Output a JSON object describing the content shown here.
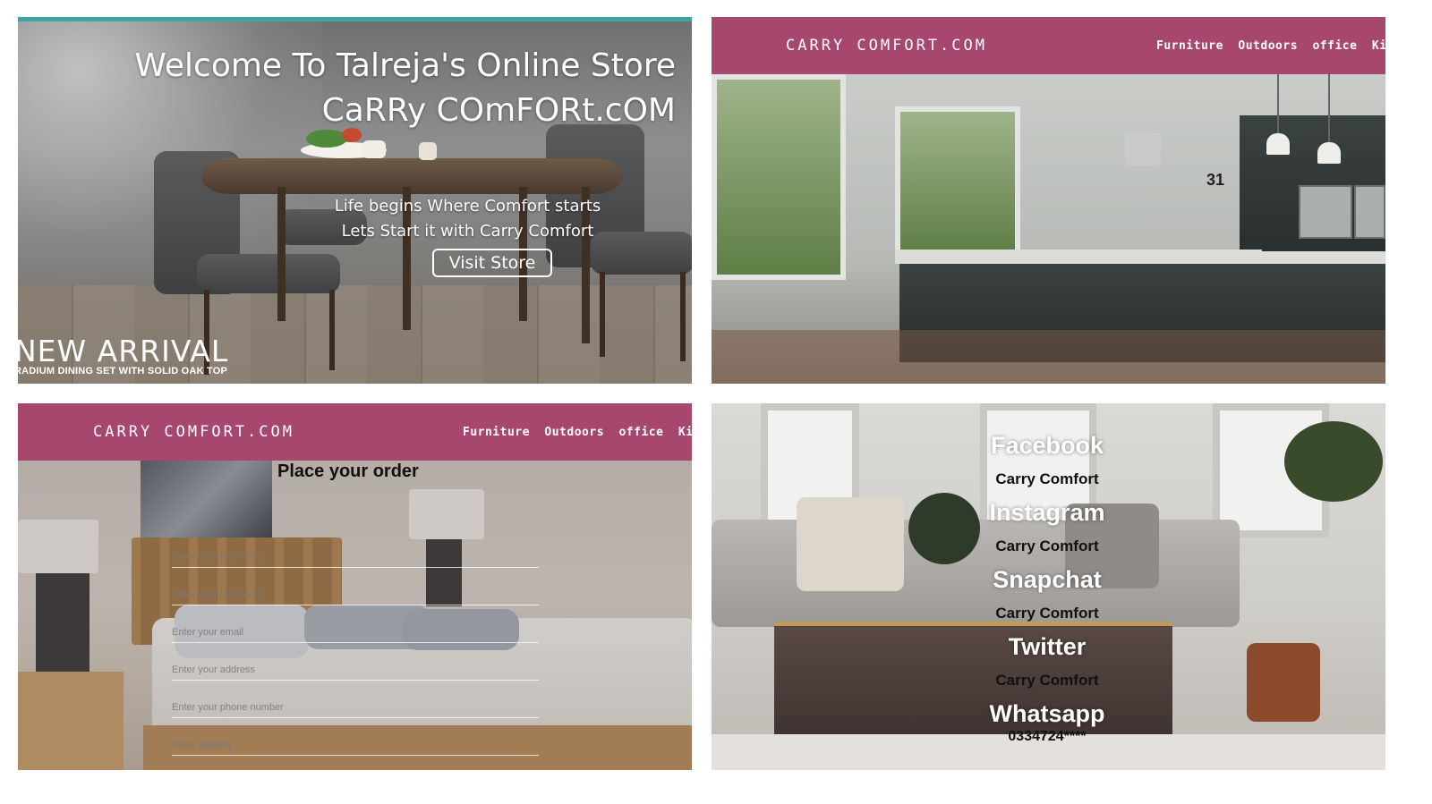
{
  "home": {
    "title_line1": "Welcome To Talreja's Online Store",
    "title_line2": "CaRRy COmFORt.cOM",
    "tagline_line1": "Life begins Where Comfort starts",
    "tagline_line2": "Lets Start it with Carry Comfort",
    "visit_button": "Visit Store",
    "new_arrival": "NEW ARRIVAL",
    "new_arrival_caption": "RADIUM DINING SET WITH SOLID OAK TOP"
  },
  "nav": {
    "brand": "CARRY COMFORT.COM",
    "links": [
      "Furniture",
      "Outdoors",
      "office",
      "Kids"
    ]
  },
  "order": {
    "title": "Place your order",
    "fields": [
      {
        "placeholder": "Enter your first name"
      },
      {
        "placeholder": "Enter your last name"
      },
      {
        "placeholder": "Enter your email"
      },
      {
        "placeholder": "Enter your address"
      },
      {
        "placeholder": "Enter your phone number"
      },
      {
        "placeholder": "Enter quantity"
      }
    ]
  },
  "contacts": {
    "items": [
      {
        "platform": "Facebook",
        "handle": "Carry Comfort"
      },
      {
        "platform": "Instagram",
        "handle": "Carry Comfort"
      },
      {
        "platform": "Snapchat",
        "handle": "Carry Comfort"
      },
      {
        "platform": "Twitter",
        "handle": "Carry Comfort"
      },
      {
        "platform": "Whatsapp",
        "handle": "0334724****"
      }
    ]
  },
  "colors": {
    "navbar": "#a8476e",
    "accent_line": "#3fa3a0"
  }
}
